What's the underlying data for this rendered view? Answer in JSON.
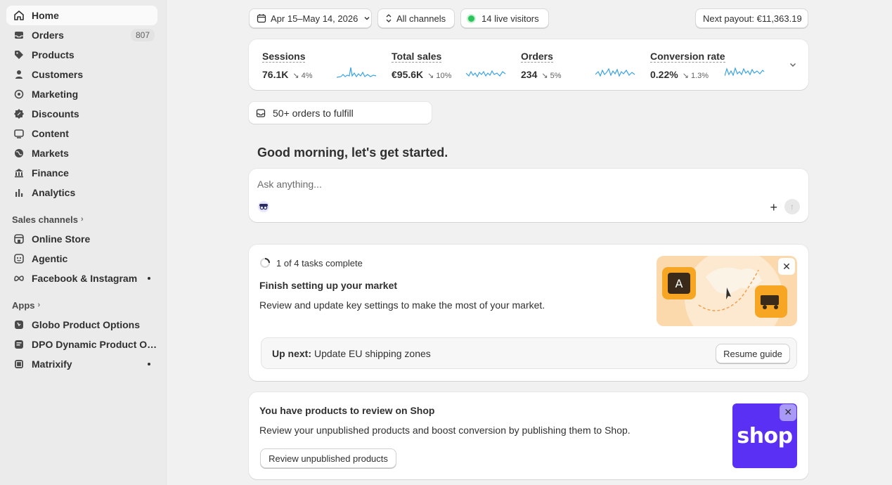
{
  "sidebar": {
    "nav": [
      {
        "label": "Home",
        "icon": "home-icon",
        "active": true
      },
      {
        "label": "Orders",
        "icon": "inbox-icon",
        "badge": "807"
      },
      {
        "label": "Products",
        "icon": "tag-icon"
      },
      {
        "label": "Customers",
        "icon": "person-icon"
      },
      {
        "label": "Marketing",
        "icon": "target-icon"
      },
      {
        "label": "Discounts",
        "icon": "discount-icon"
      },
      {
        "label": "Content",
        "icon": "content-icon"
      },
      {
        "label": "Markets",
        "icon": "globe-icon"
      },
      {
        "label": "Finance",
        "icon": "bank-icon"
      },
      {
        "label": "Analytics",
        "icon": "bar-chart-icon"
      }
    ],
    "sales_channels_title": "Sales channels",
    "sales_channels": [
      {
        "label": "Online Store",
        "icon": "store-icon"
      },
      {
        "label": "Agentic",
        "icon": "agentic-icon"
      },
      {
        "label": "Facebook & Instagram",
        "icon": "meta-icon",
        "dot": true
      }
    ],
    "apps_title": "Apps",
    "apps": [
      {
        "label": "Globo Product Options",
        "icon": "app-icon"
      },
      {
        "label": "DPO Dynamic Product Opt...",
        "icon": "app-icon"
      },
      {
        "label": "Matrixify",
        "icon": "app-icon",
        "dot": true
      }
    ]
  },
  "topbar": {
    "date_range": "Apr 15–May 14, 2026",
    "channels": "All channels",
    "live_visitors": "14 live visitors",
    "payout": "Next payout: €11,363.19"
  },
  "metrics": [
    {
      "title": "Sessions",
      "value": "76.1K",
      "change": "↘ 4%"
    },
    {
      "title": "Total sales",
      "value": "€95.6K",
      "change": "↘ 10%"
    },
    {
      "title": "Orders",
      "value": "234",
      "change": "↘ 5%"
    },
    {
      "title": "Conversion rate",
      "value": "0.22%",
      "change": "↘ 1.3%"
    }
  ],
  "fulfill": {
    "label": "50+ orders to fulfill"
  },
  "greeting": "Good morning, let's get started.",
  "ask": {
    "placeholder": "Ask anything..."
  },
  "setup": {
    "progress": "1 of 4 tasks complete",
    "title": "Finish setting up your market",
    "description": "Review and update key settings to make the most of your market.",
    "upnext_label": "Up next:",
    "upnext_text": "Update EU shipping zones",
    "resume_label": "Resume guide"
  },
  "shop": {
    "title": "You have products to review on Shop",
    "description": "Review your unpublished products and boost conversion by publishing them to Shop.",
    "button_label": "Review unpublished products",
    "logo_text": "shop"
  },
  "colors": {
    "accent": "#5a31f4",
    "live": "#29c45c",
    "spark": "#3aa3e3"
  }
}
